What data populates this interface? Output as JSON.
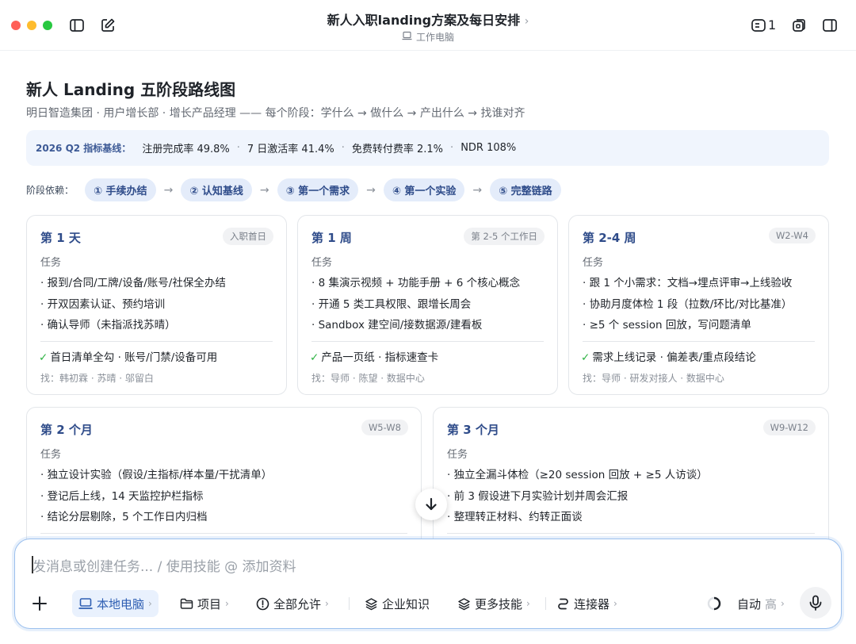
{
  "window": {
    "title": "新人入职landing方案及每日安排",
    "title_chevron": "›",
    "subtitle": "工作电脑",
    "count": "1"
  },
  "doc": {
    "title": "新人 Landing 五阶段路线图",
    "subtitle": "明日智造集团 · 用户增长部 · 增长产品经理 —— 每个阶段：学什么 → 做什么 → 产出什么 → 找谁对齐",
    "metrics": {
      "label": "2026 Q2 指标基线：",
      "items": [
        "注册完成率 49.8%",
        "7 日激活率 41.4%",
        "免费转付费率 2.1%",
        "NDR 108%"
      ],
      "separator": "·"
    },
    "deps": {
      "label": "阶段依赖：",
      "arrow": "→",
      "stages": [
        "① 手续办结",
        "② 认知基线",
        "③ 第一个需求",
        "④ 第一个实验",
        "⑤ 完整链路"
      ]
    }
  },
  "cards": [
    {
      "title": "第 1 天",
      "tag": "入职首日",
      "section": "任务",
      "items": [
        "· 报到/合同/工牌/设备/账号/社保全办结",
        "· 开双因素认证、预约培训",
        "· 确认导师（未指派找苏晴）"
      ],
      "check": "✓",
      "output": "首日清单全勾 · 账号/门禁/设备可用",
      "find": "找：韩初霖 · 苏晴 · 邬留白"
    },
    {
      "title": "第 1 周",
      "tag": "第 2-5 个工作日",
      "section": "任务",
      "items": [
        "· 8 集演示视频 + 功能手册 + 6 个核心概念",
        "· 开通 5 类工具权限、跟增长周会",
        "· Sandbox 建空间/接数据源/建看板"
      ],
      "check": "✓",
      "output": "产品一页纸 · 指标速查卡",
      "find": "找：导师 · 陈望 · 数据中心"
    },
    {
      "title": "第 2-4 周",
      "tag": "W2-W4",
      "section": "任务",
      "items": [
        "· 跟 1 个小需求：文档→埋点评审→上线验收",
        "· 协助月度体检 1 段（拉数/环比/对比基准）",
        "· ≥5 个 session 回放，写问题清单"
      ],
      "check": "✓",
      "output": "需求上线记录 · 偏差表/重点段结论",
      "find": "找：导师 · 研发对接人 · 数据中心"
    },
    {
      "title": "第 2 个月",
      "tag": "W5-W8",
      "section": "任务",
      "items": [
        "· 独立设计实验（假设/主指标/样本量/干扰清单）",
        "· 登记后上线，14 天监控护栏指标",
        "· 结论分层剔除，5 个工作日内归档"
      ]
    },
    {
      "title": "第 3 个月",
      "tag": "W9-W12",
      "section": "任务",
      "items": [
        "· 独立全漏斗体检（≥20 session 回放 + ≥5 人访谈）",
        "· 前 3 假设进下月实验计划并周会汇报",
        "· 整理转正材料、约转正面谈"
      ]
    }
  ],
  "composer": {
    "placeholder": "发消息或创建任务... / 使用技能 @ 添加资料",
    "tools": {
      "local": "本地电脑",
      "project": "项目",
      "allow": "全部允许",
      "knowledge": "企业知识",
      "skills": "更多技能",
      "connector": "连接器",
      "auto": "自动",
      "level": "高",
      "chevron": "›"
    }
  },
  "colors": {
    "accent": "#2f4c8a",
    "pill_bg": "#e4ecfa",
    "metrics_bg": "#f0f5fd",
    "check": "#2fb344",
    "composer_border": "#9cc0ee"
  }
}
